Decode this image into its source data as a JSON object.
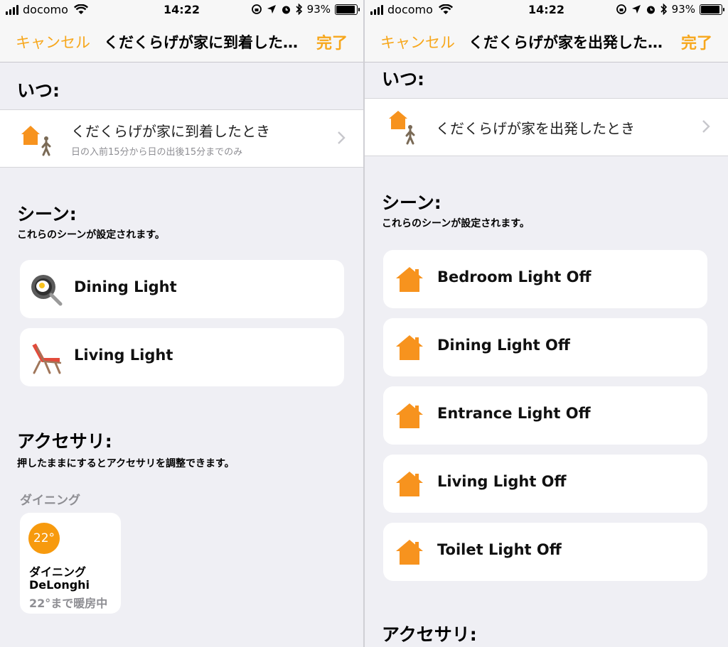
{
  "colors": {
    "accent": "#f7a71c",
    "house": "#f7931e",
    "background": "#efeff4"
  },
  "status_bar": {
    "carrier": "docomo",
    "time": "14:22",
    "battery": "93%",
    "battery_level": 0.93
  },
  "left": {
    "nav": {
      "cancel": "キャンセル",
      "title": "くだくらげが家に到着した…",
      "done": "完了"
    },
    "when": {
      "heading": "いつ:",
      "trigger_title": "くだくらげが家に到着したとき",
      "trigger_sub": "日の入前15分から日の出後15分までのみ",
      "icon": "house-arrive-icon"
    },
    "scenes": {
      "heading": "シーン:",
      "subtitle": "これらのシーンが設定されます。",
      "items": [
        {
          "label": "Dining Light",
          "icon": "frying-pan-icon"
        },
        {
          "label": "Living Light",
          "icon": "lounge-chair-icon"
        }
      ]
    },
    "accessories": {
      "heading": "アクセサリ:",
      "subtitle": "押したままにするとアクセサリを調整できます。",
      "room": "ダイニング",
      "tile": {
        "temp": "22°",
        "room": "ダイニング",
        "name": "DeLonghi",
        "status": "22°まで暖房中"
      }
    }
  },
  "right": {
    "nav": {
      "cancel": "キャンセル",
      "title": "くだくらげが家を出発した…",
      "done": "完了"
    },
    "when": {
      "heading": "いつ:",
      "trigger_title": "くだくらげが家を出発したとき",
      "icon": "house-leave-icon"
    },
    "scenes": {
      "heading": "シーン:",
      "subtitle": "これらのシーンが設定されます。",
      "items": [
        {
          "label": "Bedroom Light Off",
          "icon": "house-icon"
        },
        {
          "label": "Dining Light Off",
          "icon": "house-icon"
        },
        {
          "label": "Entrance Light Off",
          "icon": "house-icon"
        },
        {
          "label": "Living Light Off",
          "icon": "house-icon"
        },
        {
          "label": "Toilet Light Off",
          "icon": "house-icon"
        }
      ]
    },
    "accessories": {
      "heading": "アクセサリ:"
    }
  }
}
